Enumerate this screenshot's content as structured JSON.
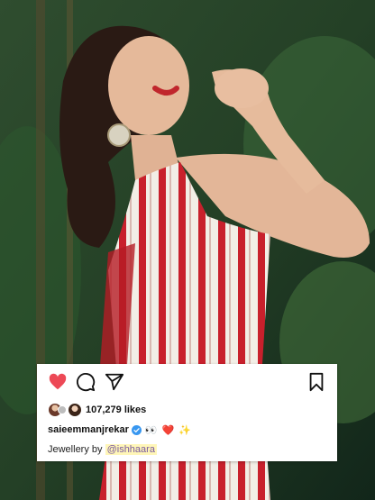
{
  "post": {
    "likes": "107,279 likes",
    "username": "saieemmanjrekar",
    "caption_emojis": "👀 ❤️ ✨",
    "comment_prefix": "Jewellery by ",
    "comment_mention": "@ishhaara"
  },
  "icons": {
    "like": "heart-icon",
    "comment": "comment-icon",
    "share": "send-icon",
    "save": "bookmark-icon",
    "verified": "verified-badge-icon"
  },
  "colors": {
    "like_red": "#ed4956",
    "verified_blue": "#3897f0",
    "mention_highlight": "#fff6b8"
  }
}
